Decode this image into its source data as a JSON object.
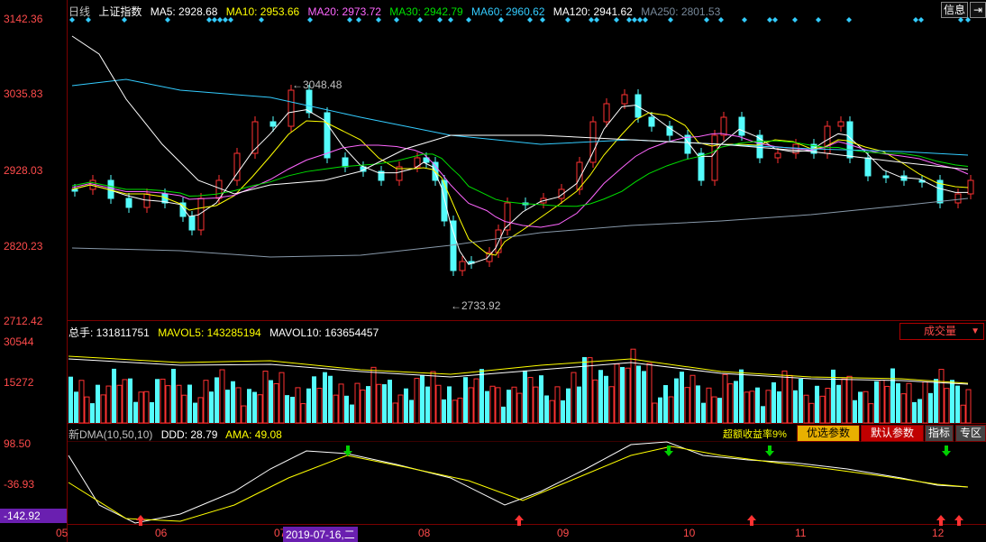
{
  "header": {
    "period": "日线",
    "index_name": "上证指数",
    "ma": [
      {
        "label": "MA5: 2928.68",
        "color": "#ffffff"
      },
      {
        "label": "MA10: 2953.66",
        "color": "#ffff00"
      },
      {
        "label": "MA20: 2973.72",
        "color": "#ff66ff"
      },
      {
        "label": "MA30: 2942.79",
        "color": "#00e000"
      },
      {
        "label": "MA60: 2960.62",
        "color": "#33ccff"
      },
      {
        "label": "MA120: 2941.62",
        "color": "#ffffff"
      },
      {
        "label": "MA250: 2801.53",
        "color": "#778899"
      }
    ],
    "info_button": "信息",
    "arrow_button": "⇥"
  },
  "price_axis": [
    "3142.36",
    "3035.83",
    "2928.03",
    "2820.23",
    "2712.42"
  ],
  "annotations": {
    "high": "3048.48",
    "low": "2733.92"
  },
  "volume": {
    "label_total": "总手: 131811751",
    "label_mavol5": "MAVOL5: 143285194",
    "label_mavol10": "MAVOL10: 163654457",
    "axis": [
      "30544",
      "15272"
    ],
    "selector": "成交量"
  },
  "dma": {
    "label": "新DMA(10,50,10)",
    "ddd": "DDD: 28.79",
    "ama": "AMA: 49.08",
    "axis": [
      "98.50",
      "-36.93",
      "-142.92"
    ],
    "promo_text": "超额收益率9%",
    "btn_optimize": "优选参数",
    "btn_default": "默认参数",
    "btn_indicator": "指标",
    "btn_zone": "专区"
  },
  "time_axis": {
    "months": [
      "05",
      "06",
      "07",
      "08",
      "09",
      "10",
      "11",
      "12"
    ],
    "cursor_date": "2019-07-16,二"
  },
  "colors": {
    "up": "#ff3232",
    "down": "#54fcfc",
    "grid": "#7a0000",
    "axis_text": "#ff4b4b"
  }
}
